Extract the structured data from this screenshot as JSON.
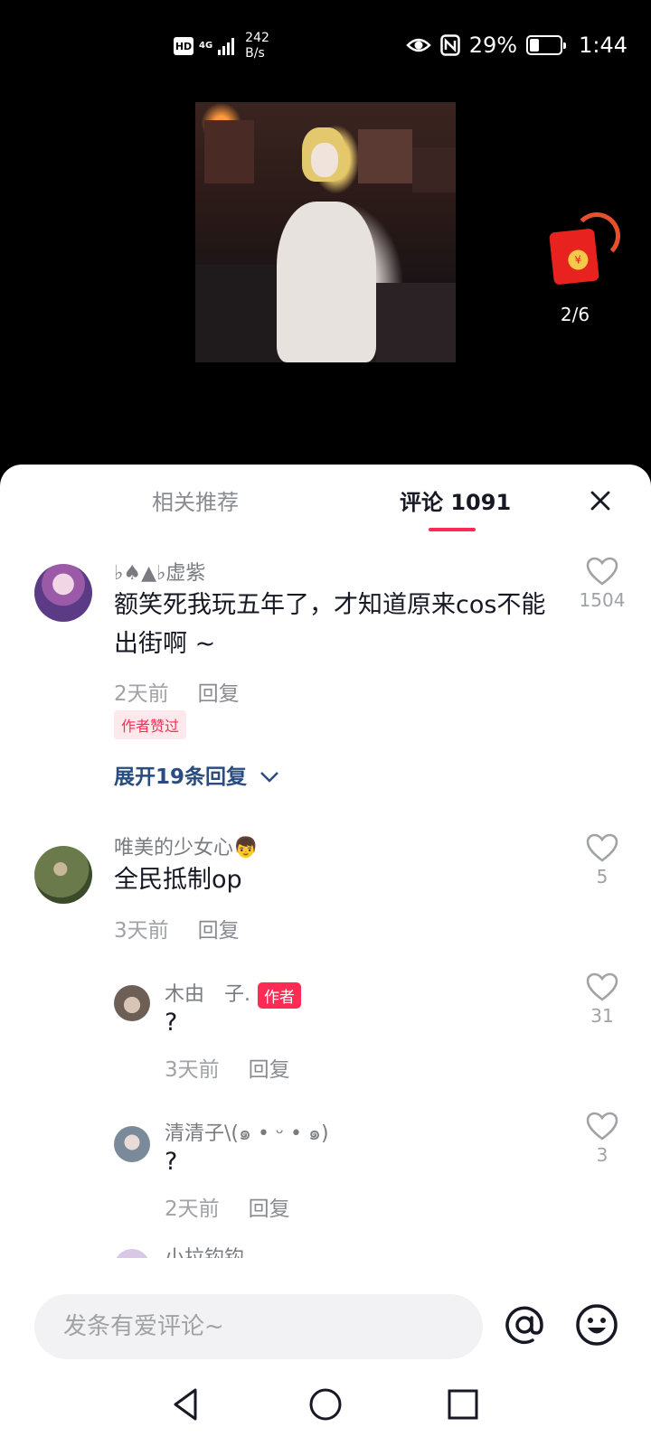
{
  "status_bar": {
    "hd": "HD",
    "network": "4G",
    "speed_value": "242",
    "speed_unit": "B/s",
    "battery": "29%",
    "time": "1:44"
  },
  "video": {
    "red_packet_count": "2/6"
  },
  "sheet": {
    "tab_related": "相关推荐",
    "tab_comments": "评论 1091"
  },
  "comments": [
    {
      "username": "♭♠▲♭虚紫",
      "text": "额笑死我玩五年了，才知道原来cos不能出街啊 ~",
      "time": "2天前",
      "reply": "回复",
      "badge": "作者赞过",
      "likes": "1504",
      "expand": "展开19条回复"
    },
    {
      "username": "唯美的少女心👦",
      "text": "全民抵制op",
      "time": "3天前",
      "reply": "回复",
      "likes": "5"
    }
  ],
  "replies": [
    {
      "username": "木由　子.",
      "author_tag": "作者",
      "text": "?",
      "time": "3天前",
      "reply": "回复",
      "likes": "31"
    },
    {
      "username": "清清子\\(๑ • ᵕ • ๑)",
      "text": "?",
      "time": "2天前",
      "reply": "回复",
      "likes": "3"
    },
    {
      "username": "小拉钩钩"
    }
  ],
  "input": {
    "placeholder": "发条有爱评论~"
  },
  "colors": {
    "accent": "#fe2c55",
    "link": "#2b4c7e"
  }
}
